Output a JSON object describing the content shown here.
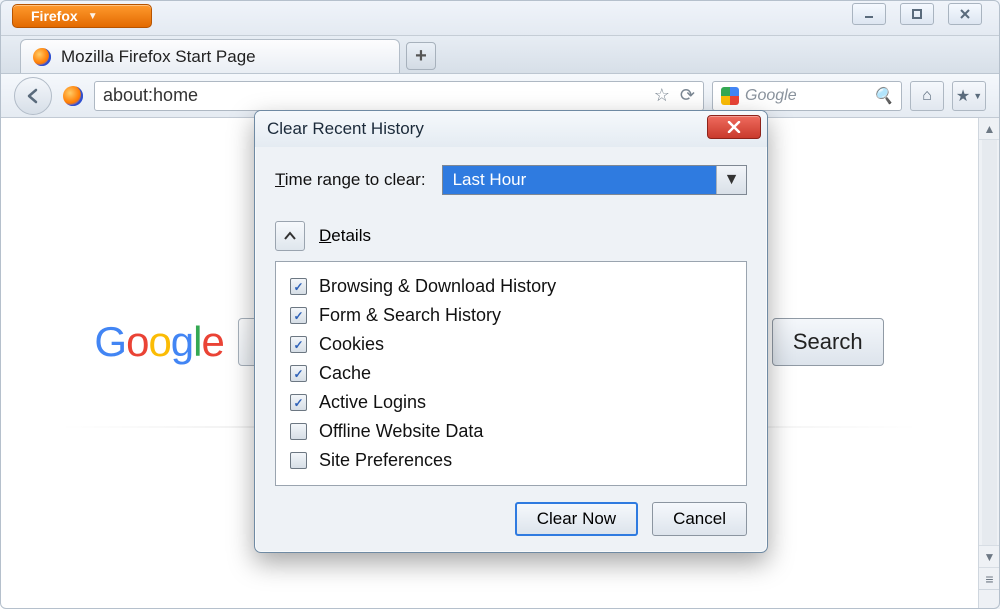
{
  "app": {
    "menu_label": "Firefox"
  },
  "tab": {
    "title": "Mozilla Firefox Start Page"
  },
  "urlbar": {
    "value": "about:home"
  },
  "searchbox": {
    "placeholder": "Google"
  },
  "page": {
    "logo_chars": [
      "G",
      "o",
      "o",
      "g",
      "l",
      "e"
    ],
    "search_button": "Search"
  },
  "dialog": {
    "title": "Clear Recent History",
    "time_label_pre": "T",
    "time_label_rest": "ime range to clear:",
    "time_value": "Last Hour",
    "details_pre": "D",
    "details_rest": "etails",
    "items": [
      {
        "label": "Browsing & Download History",
        "checked": true
      },
      {
        "label": "Form & Search History",
        "checked": true
      },
      {
        "label": "Cookies",
        "checked": true
      },
      {
        "label": "Cache",
        "checked": true
      },
      {
        "label": "Active Logins",
        "checked": true
      },
      {
        "label": "Offline Website Data",
        "checked": false
      },
      {
        "label": "Site Preferences",
        "checked": false
      }
    ],
    "clear_now": "Clear Now",
    "cancel": "Cancel"
  }
}
